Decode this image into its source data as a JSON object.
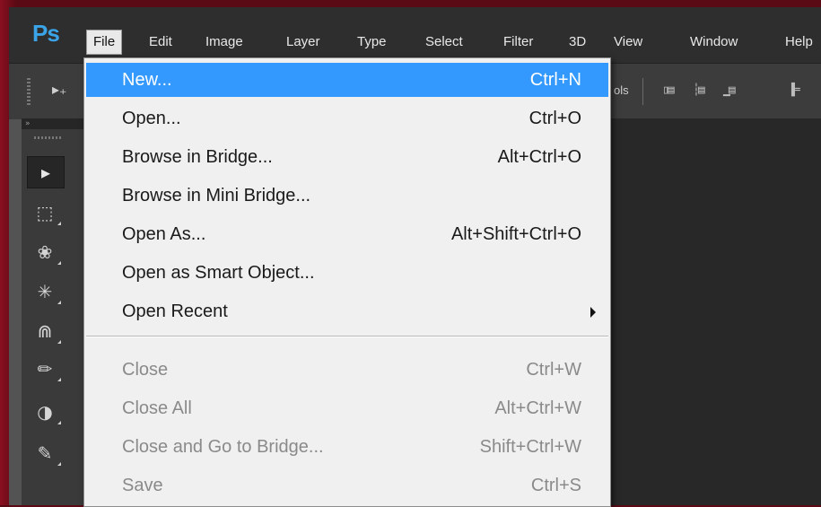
{
  "app": {
    "logo": "Ps"
  },
  "menubar": {
    "items": [
      "File",
      "Edit",
      "Image",
      "Layer",
      "Type",
      "Select",
      "Filter",
      "3D",
      "View",
      "Window",
      "Help"
    ]
  },
  "options_bar": {
    "partial_label": "ols"
  },
  "file_menu": {
    "items": [
      {
        "label": "New...",
        "shortcut": "Ctrl+N"
      },
      {
        "label": "Open...",
        "shortcut": "Ctrl+O"
      },
      {
        "label": "Browse in Bridge...",
        "shortcut": "Alt+Ctrl+O"
      },
      {
        "label": "Browse in Mini Bridge...",
        "shortcut": ""
      },
      {
        "label": "Open As...",
        "shortcut": "Alt+Shift+Ctrl+O"
      },
      {
        "label": "Open as Smart Object...",
        "shortcut": ""
      },
      {
        "label": "Open Recent",
        "shortcut": ""
      },
      {
        "label": "Close",
        "shortcut": "Ctrl+W"
      },
      {
        "label": "Close All",
        "shortcut": "Alt+Ctrl+W"
      },
      {
        "label": "Close and Go to Bridge...",
        "shortcut": "Shift+Ctrl+W"
      },
      {
        "label": "Save",
        "shortcut": "Ctrl+S"
      }
    ]
  },
  "icons": {
    "move_tool": "move-icon",
    "marquee_tool": "marquee-icon",
    "lasso_tool": "lasso-icon",
    "magic_wand_tool": "magic-wand-icon",
    "crop_tool": "crop-icon",
    "eyedropper_tool": "eyedropper-icon",
    "healing_tool": "bandage-icon",
    "brush_tool": "brush-icon"
  },
  "colors": {
    "highlight": "#3399ff",
    "logo": "#3ba3e8",
    "menubar_bg": "#2e2e2e",
    "menu_bg": "#f0f0f0"
  }
}
